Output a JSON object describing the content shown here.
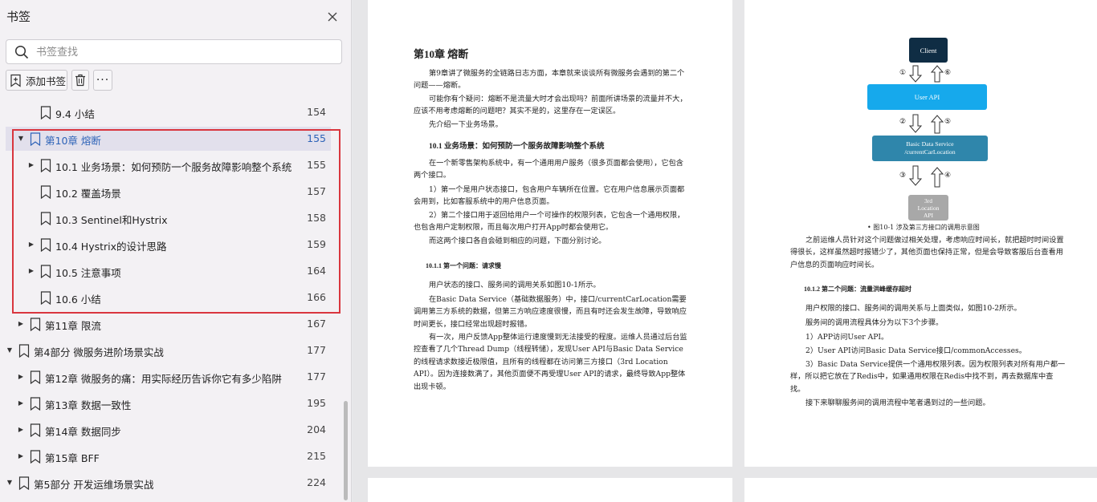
{
  "sidebar": {
    "title": "书签",
    "search_placeholder": "书签查找",
    "toolbar": {
      "add_label": "添加书签",
      "more_label": "···"
    },
    "items": [
      {
        "label": "9.4 小结",
        "page": "154",
        "level": 2,
        "arrow": ""
      },
      {
        "label": "第10章 熔断",
        "page": "155",
        "level": 1,
        "arrow": "▼",
        "selected": true
      },
      {
        "label": "10.1 业务场景：如何预防一个服务故障影响整个系统",
        "page": "155",
        "level": 2,
        "arrow": "▶"
      },
      {
        "label": "10.2 覆盖场景",
        "page": "157",
        "level": 2,
        "arrow": ""
      },
      {
        "label": "10.3 Sentinel和Hystrix",
        "page": "158",
        "level": 2,
        "arrow": ""
      },
      {
        "label": "10.4 Hystrix的设计思路",
        "page": "159",
        "level": 2,
        "arrow": "▶"
      },
      {
        "label": "10.5 注意事项",
        "page": "164",
        "level": 2,
        "arrow": "▶"
      },
      {
        "label": "10.6 小结",
        "page": "166",
        "level": 2,
        "arrow": ""
      },
      {
        "label": "第11章 限流",
        "page": "167",
        "level": 1,
        "arrow": "▶"
      },
      {
        "label": "第4部分 微服务进阶场景实战",
        "page": "177",
        "level": 0,
        "arrow": "▼"
      },
      {
        "label": "第12章 微服务的痛：用实际经历告诉你它有多少陷阱",
        "page": "177",
        "level": 1,
        "arrow": "▶"
      },
      {
        "label": "第13章 数据一致性",
        "page": "195",
        "level": 1,
        "arrow": "▶"
      },
      {
        "label": "第14章 数据同步",
        "page": "204",
        "level": 1,
        "arrow": "▶"
      },
      {
        "label": "第15章 BFF",
        "page": "215",
        "level": 1,
        "arrow": "▶"
      },
      {
        "label": "第5部分 开发运维场景实战",
        "page": "224",
        "level": 0,
        "arrow": "▼"
      }
    ]
  },
  "page1": {
    "chapter_title": "第10章 熔断",
    "p1": "第9章讲了微服务的全链路日志方面，本章就来谈谈所有微服务会遇到的第二个问题——熔断。",
    "p2": "可能你有个疑问：熔断不是流量大时才会出现吗？前面所讲场景的流量并不大，应该不用考虑熔断的问题吧？其实不是的，这里存在一定误区。",
    "p3": "先介绍一下业务场景。",
    "sec1": "10.1 业务场景：如何预防一个服务故障影响整个系统",
    "p4": "在一个新零售架构系统中，有一个通用用户服务（很多页面都会使用），它包含两个接口。",
    "p5": "1）第一个是用户状态接口，包含用户车辆所在位置。它在用户信息展示页面都会用到，比如客服系统中的用户信息页面。",
    "p6": "2）第二个接口用于返回给用户一个可操作的权限列表，它包含一个通用权限，也包含用户定制权限，而且每次用户打开App时都会使用它。",
    "p7": "而这两个接口各自会碰到相应的问题，下面分别讨论。",
    "subsec1": "10.1.1 第一个问题：请求慢",
    "p8": "用户状态的接口、服务间的调用关系如图10-1所示。",
    "p9": "在Basic Data Service（基础数据服务）中，接口/currentCarLocation需要调用第三方系统的数据，但第三方响应速度很慢，而且有时还会发生故障，导致响应时间更长，接口经常出现超时报错。",
    "p10": "有一次，用户反馈App整体运行速度慢到无法接受的程度。运维人员通过后台监控查看了几个Thread Dump（线程转储），发现User API与Basic Data Service的线程请求数接近极限值，且所有的线程都在访问第三方接口（3rd Location API）。因为连接数满了，其他页面便不再受理User API的请求，最终导致App整体出现卡顿。"
  },
  "page2": {
    "diagram": {
      "client": "Client",
      "user_api": "User API",
      "basic_data": "Basic Data Service\n/currentCarLocation",
      "location": "3rd\nLocation\nAPI",
      "n1": "①",
      "n2": "②",
      "n3": "③",
      "n4": "④",
      "n5": "⑤",
      "n6": "⑥",
      "colors": {
        "client": "#0f2d44",
        "user_api": "#16a9ec",
        "basic_data": "#2f86ab",
        "location": "#a8a8a8"
      }
    },
    "fig_caption": "• 图10-1 涉及第三方接口的调用示意图",
    "p1": "之前运维人员针对这个问题做过相关处理，考虑响应时间长，就把超时时间设置得很长，这样虽然超时报错少了，其他页面也保持正常，但是会导致客服后台查看用户信息的页面响应时间长。",
    "subsec2": "10.1.2 第二个问题：流量洪峰缓存超时",
    "p2": "用户权限的接口、服务间的调用关系与上面类似，如图10-2所示。",
    "p3": "服务间的调用流程具体分为以下3个步骤。",
    "p4": "1）APP访问User API。",
    "p5": "2）User API访问Basic Data Service接口/commonAccesses。",
    "p6": "3）Basic Data Service提供一个通用权限列表。因为权限列表对所有用户都一样，所以把它放在了Redis中，如果通用权限在Redis中找不到，再去数据库中查找。",
    "p7": "接下来聊聊服务间的调用流程中笔者遇到过的一些问题。"
  }
}
